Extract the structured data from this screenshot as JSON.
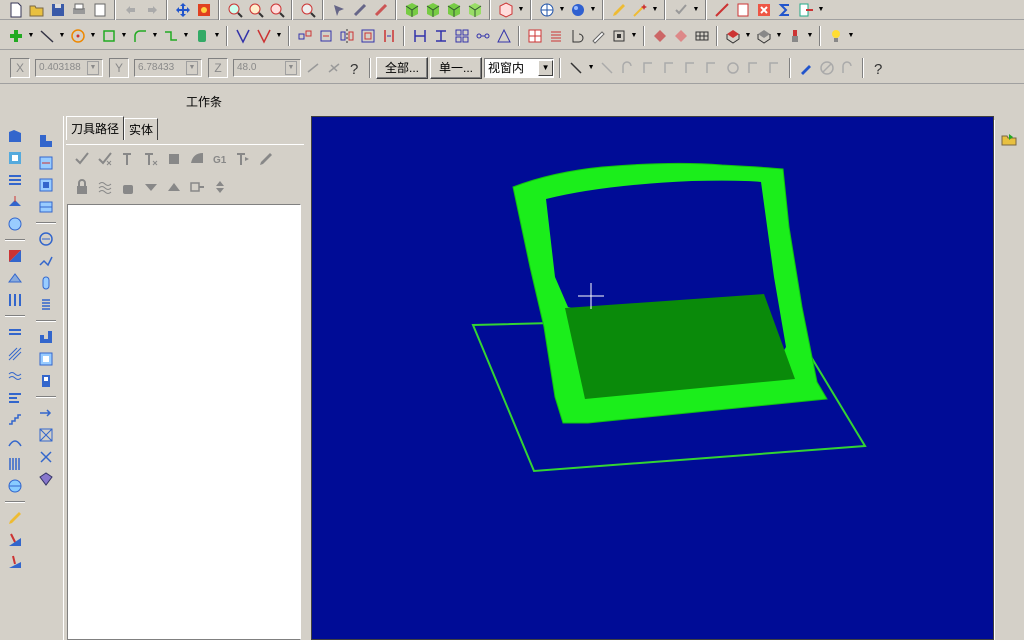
{
  "toolbar_coords": {
    "x_label": "X",
    "x_value": "0.403188",
    "y_label": "Y",
    "y_value": "6.78433",
    "z_label": "Z",
    "z_value": "48.0",
    "all_button": "全部...",
    "single_button": "单一...",
    "view_select": "视窗内"
  },
  "workbar": {
    "title": "工作条"
  },
  "panel": {
    "tabs": [
      {
        "label": "刀具路径"
      },
      {
        "label": "实体"
      }
    ]
  },
  "icons": {
    "toolbar1": [
      "new-file-icon",
      "open-file-icon",
      "save-icon",
      "print-icon",
      "print-preview-icon",
      "undo-icon",
      "redo-icon",
      "pan-icon",
      "repaint-icon",
      "zoom-window-icon",
      "zoom-fit-icon",
      "zoom-out-icon",
      "zoom-unzoom-icon",
      "select-icon",
      "view-iso-icon",
      "view-top-icon",
      "shade-cube-icon",
      "view-front-icon",
      "view-side-icon",
      "cube-red-icon",
      "globe-icon",
      "sphere-icon",
      "edit-pencil-icon",
      "wand-icon",
      "checkmark-icon",
      "plot-icon",
      "delete-icon",
      "sigma-icon",
      "exit-icon"
    ],
    "toolbar2": [
      "point-icon",
      "line-icon",
      "circle-icon",
      "rectangle-icon",
      "fillet-icon",
      "chamfer-icon",
      "solid-icon",
      "trim-icon",
      "break-icon",
      "transform-translate-icon",
      "transform-rotate-icon",
      "mirror-icon",
      "scale-icon",
      "offset-icon",
      "align-icon",
      "array-icon",
      "stretch-icon",
      "dimension-icon",
      "grid-icon",
      "list-icon",
      "sketch-icon",
      "wrap-icon",
      "box-icon",
      "toolpath-icon",
      "surface-icon",
      "wireframe-icon",
      "solid-box-icon",
      "tool-icon",
      "light-icon"
    ],
    "toolbar3": [
      "line-tool-icon",
      "auto-cursor-icon",
      "arc-icon",
      "endpoint-icon",
      "midpoint-icon",
      "center-icon",
      "quadrant-icon",
      "intersection-icon",
      "nearest-icon",
      "normal-icon",
      "pick-icon",
      "erase-icon",
      "help-icon"
    ],
    "leftbar1": [
      "contour-icon",
      "pocket-icon",
      "face-icon",
      "drill-icon",
      "circle-mill-icon",
      "surface-rough-icon",
      "surface-finish-icon",
      "multiaxis-icon",
      "equal-icon",
      "hatch-icon",
      "wave-icon",
      "text-icon",
      "dots-icon",
      "draw-icon",
      "wrap-flow-icon",
      "sphere-toolpath-icon",
      "pencil-tool-icon",
      "rough-tool-icon",
      "finish-tool-icon"
    ],
    "leftbar2": [
      "op-manager-icon",
      "stock-icon",
      "fixture-icon",
      "holder-icon",
      "theta-icon",
      "link-icon",
      "slot-icon",
      "spring-icon",
      "layer-icon",
      "frame-icon",
      "post-icon",
      "arrow-icon",
      "transform-icon",
      "mark-icon",
      "gem-icon"
    ],
    "panel_row1": [
      "select-all-icon",
      "select-failed-icon",
      "regen-icon",
      "regen-dirty-icon",
      "backplot-icon",
      "verify-icon",
      "gcode-icon",
      "highfeed-icon",
      "edit-icon"
    ],
    "panel_row2": [
      "lock-icon",
      "toggle-display-icon",
      "post-lock-icon",
      "move-down-icon",
      "move-up-icon",
      "insert-arrow-icon",
      "expand-icon"
    ],
    "rightbar": [
      "open-folder-icon"
    ]
  },
  "colors": {
    "viewport_bg": "#000c96",
    "part_green": "#1bee1b",
    "part_floor": "#0a8a0a",
    "wire_green": "#33d433"
  }
}
